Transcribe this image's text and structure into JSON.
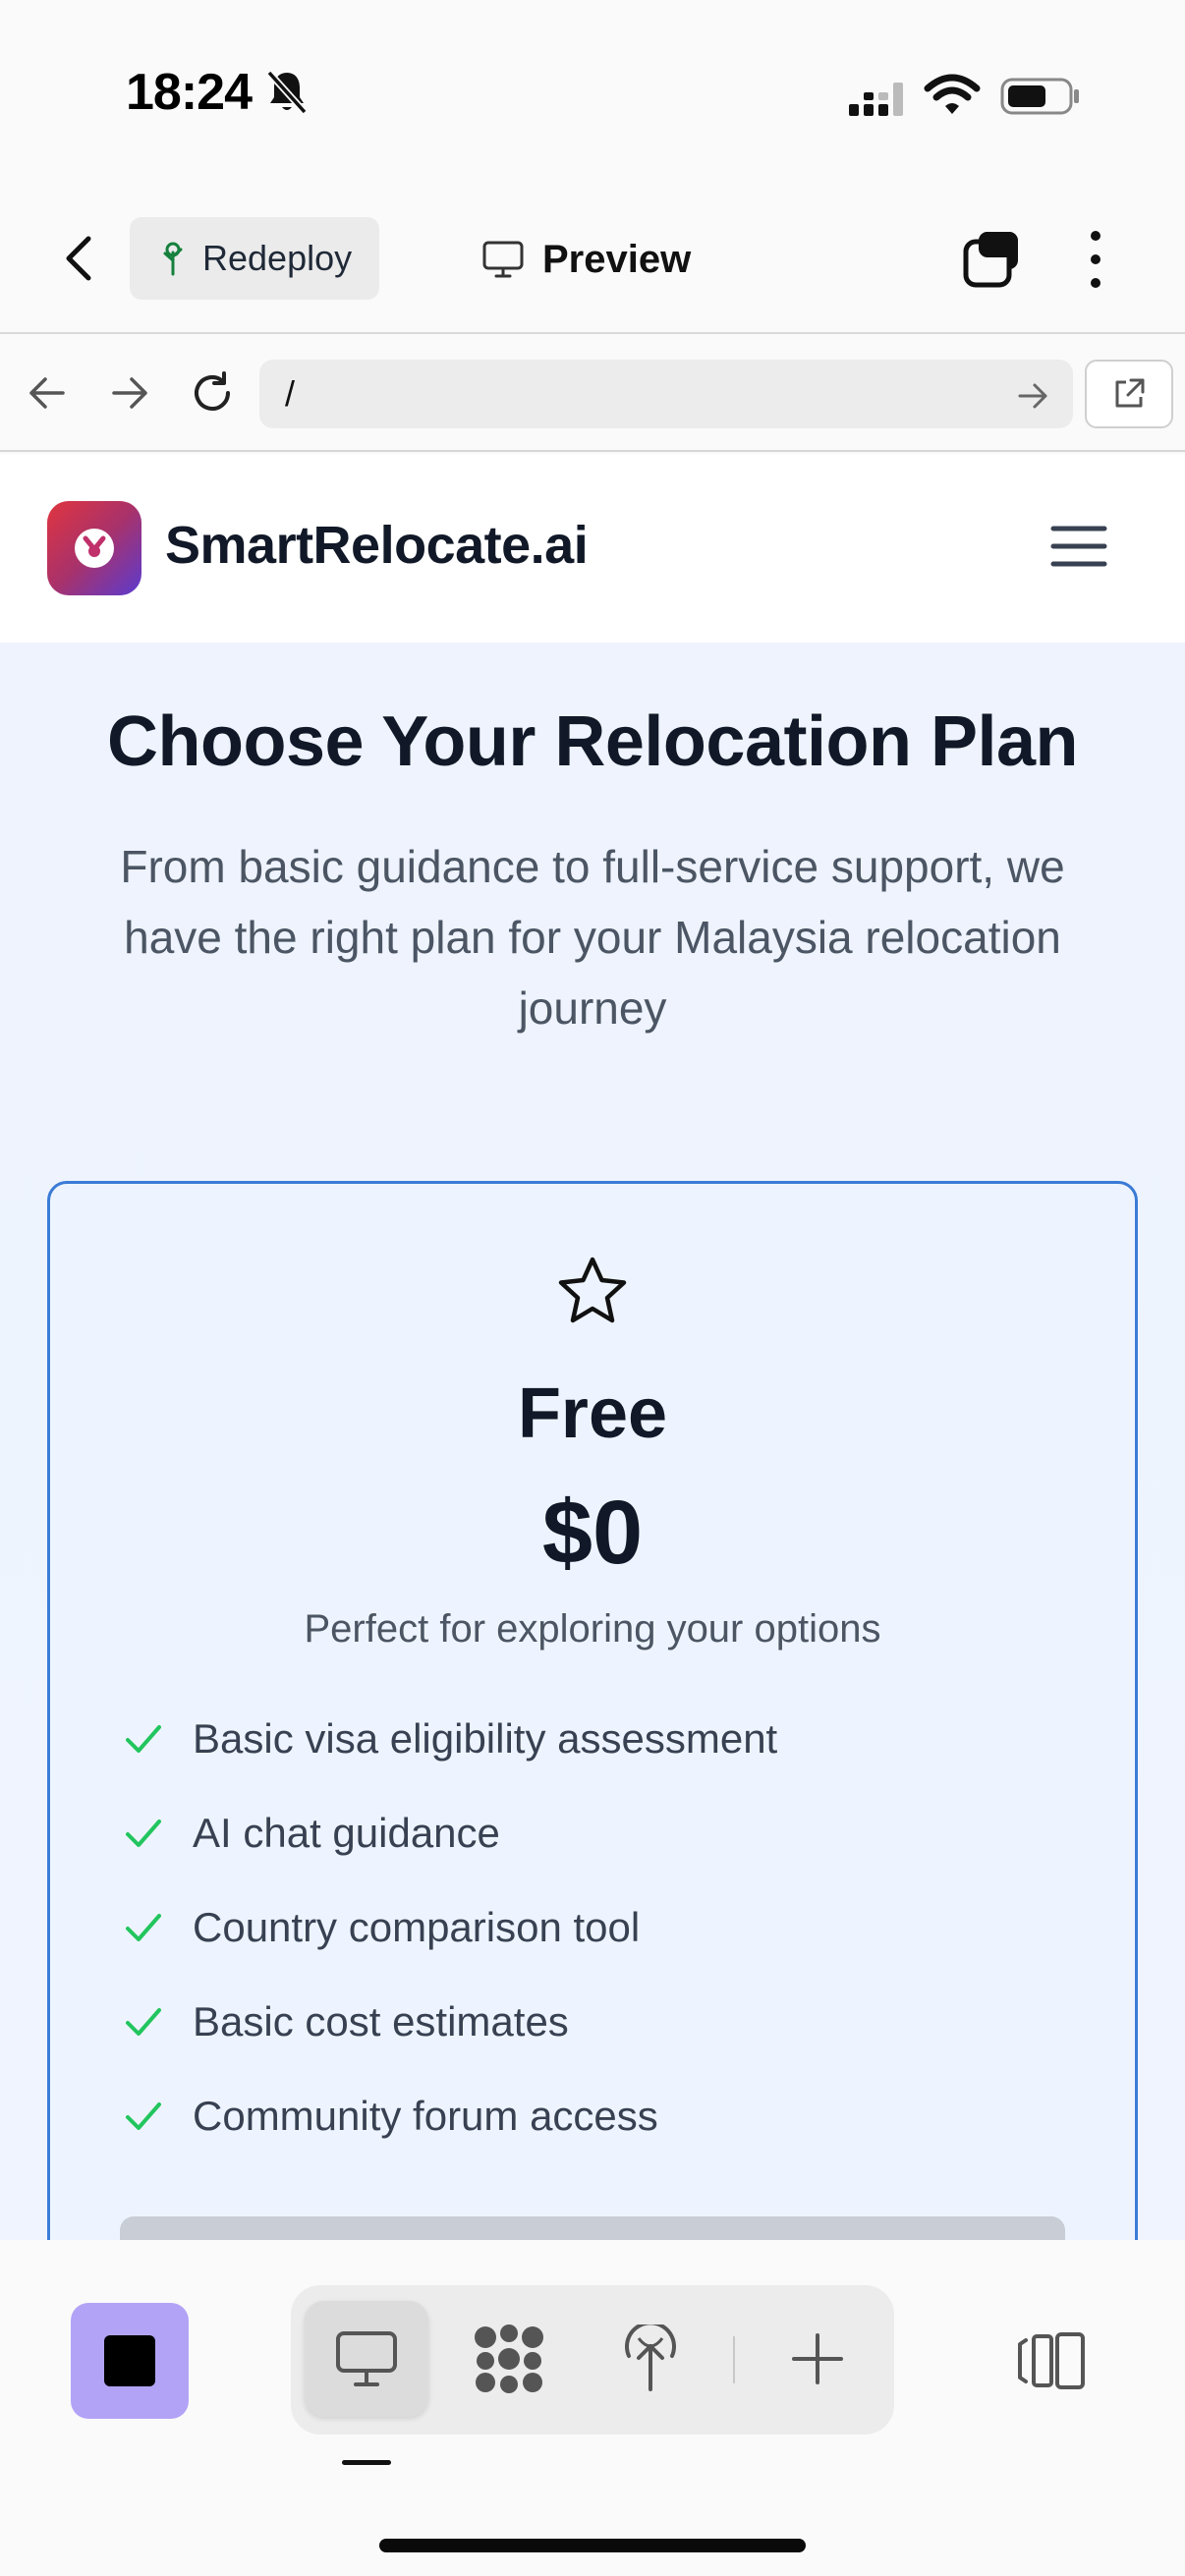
{
  "status_bar": {
    "time": "18:24"
  },
  "app_header": {
    "redeploy_label": "Redeploy",
    "preview_label": "Preview"
  },
  "browser": {
    "url": "/"
  },
  "site": {
    "name": "SmartRelocate.ai"
  },
  "page": {
    "title": "Choose Your Relocation Plan",
    "subtitle": "From basic guidance to full-service support, we have the right plan for your Malaysia relocation journey"
  },
  "plan": {
    "name": "Free",
    "price": "$0",
    "description": "Perfect for exploring your options",
    "features": [
      "Basic visa eligibility assessment",
      "AI chat guidance",
      "Country comparison tool",
      "Basic cost estimates",
      "Community forum access"
    ]
  },
  "colors": {
    "accent_blue": "#3b7bd6",
    "check_green": "#22c55e",
    "stop_purple": "#b3a3f7",
    "logo_gradient_start": "#e0343f",
    "logo_gradient_end": "#5b3bcf"
  },
  "icons": [
    "bell-slash-icon",
    "signal-icon",
    "wifi-icon",
    "battery-icon",
    "back-chevron-icon",
    "tree-icon",
    "monitor-icon",
    "tabs-icon",
    "more-vertical-icon",
    "arrow-left-icon",
    "arrow-right-icon",
    "reload-icon",
    "open-external-icon",
    "hamburger-icon",
    "star-icon",
    "check-icon",
    "nodes-icon",
    "deploy-icon",
    "plus-icon",
    "split-view-icon"
  ]
}
